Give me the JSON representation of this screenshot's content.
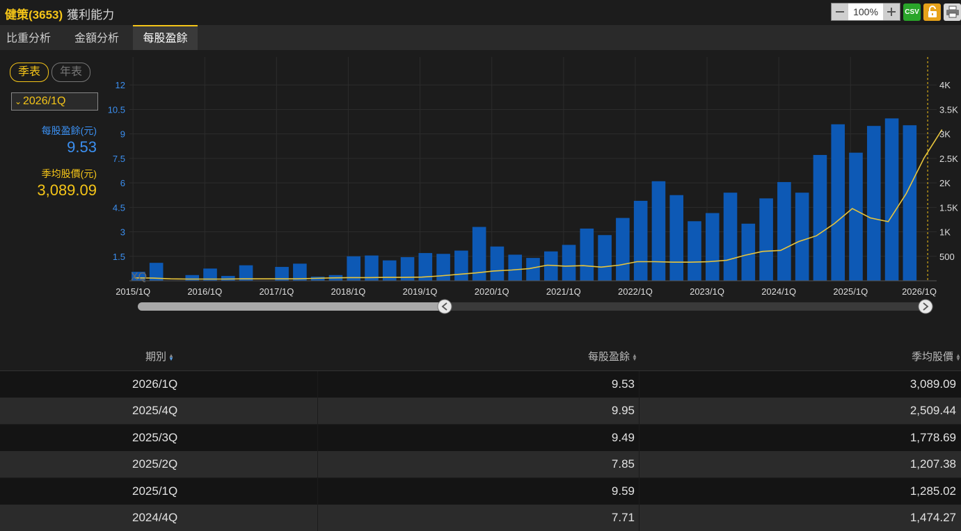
{
  "header": {
    "stock": "健策(3653)",
    "page": "獲利能力",
    "zoom_level": "100%",
    "csv_label": "CSV",
    "zoom_out_icon": "minus-icon",
    "zoom_in_icon": "plus-icon",
    "lock_icon": "lock-icon",
    "print_icon": "printer-icon"
  },
  "tabs": [
    {
      "label": "比重分析",
      "active": false
    },
    {
      "label": "金額分析",
      "active": false
    },
    {
      "label": "每股盈餘",
      "active": true
    }
  ],
  "controls": {
    "quarterly": "季表",
    "annual": "年表",
    "period": "2026/1Q"
  },
  "summary": {
    "eps_label": "每股盈餘(元)",
    "eps_value": "9.53",
    "price_label": "季均股價(元)",
    "price_value": "3,089.09"
  },
  "colors": {
    "bar": "#0d59b5",
    "bar_highlight": "#1a8cff",
    "line": "#e8c53c",
    "accent": "#f5c518",
    "left_axis": "#3b8ff0"
  },
  "chart_data": {
    "type": "bar",
    "watermark": "XQ",
    "x_tick_labels": [
      "2015/1Q",
      "2016/1Q",
      "2017/1Q",
      "2018/1Q",
      "2019/1Q",
      "2020/1Q",
      "2021/1Q",
      "2022/1Q",
      "2023/1Q",
      "2024/1Q",
      "2025/1Q",
      "2026/1Q"
    ],
    "left_ticks": [
      "1.5",
      "3",
      "4.5",
      "6",
      "7.5",
      "9",
      "10.5",
      "12"
    ],
    "right_ticks": [
      "500",
      "1K",
      "1.5K",
      "2K",
      "2.5K",
      "3K",
      "3.5K",
      "4K"
    ],
    "ylim_left": [
      0,
      13.5
    ],
    "ylim_right": [
      0,
      4500
    ],
    "grid": true,
    "categories": [
      "2015/1Q",
      "2015/2Q",
      "2015/3Q",
      "2015/4Q",
      "2016/1Q",
      "2016/2Q",
      "2016/3Q",
      "2016/4Q",
      "2017/1Q",
      "2017/2Q",
      "2017/3Q",
      "2017/4Q",
      "2018/1Q",
      "2018/2Q",
      "2018/3Q",
      "2018/4Q",
      "2019/1Q",
      "2019/2Q",
      "2019/3Q",
      "2019/4Q",
      "2020/1Q",
      "2020/2Q",
      "2020/3Q",
      "2020/4Q",
      "2021/1Q",
      "2021/2Q",
      "2021/3Q",
      "2021/4Q",
      "2022/1Q",
      "2022/2Q",
      "2022/3Q",
      "2022/4Q",
      "2023/1Q",
      "2023/2Q",
      "2023/3Q",
      "2023/4Q",
      "2024/1Q",
      "2024/2Q",
      "2024/3Q",
      "2024/4Q",
      "2025/1Q",
      "2025/2Q",
      "2025/3Q",
      "2025/4Q",
      "2026/1Q"
    ],
    "series": [
      {
        "name": "每股盈餘(元)",
        "axis": "left",
        "kind": "bar",
        "values": [
          0.55,
          1.1,
          0.0,
          0.35,
          0.75,
          0.3,
          0.95,
          0.0,
          0.85,
          1.05,
          0.25,
          0.35,
          1.5,
          1.55,
          1.25,
          1.45,
          1.7,
          1.65,
          1.85,
          3.3,
          2.1,
          1.6,
          1.4,
          1.8,
          2.2,
          3.2,
          2.8,
          3.85,
          4.9,
          6.1,
          5.25,
          3.65,
          4.15,
          5.4,
          3.5,
          5.05,
          6.05,
          5.4,
          7.71,
          9.59,
          7.85,
          9.49,
          9.95,
          9.53
        ]
      },
      {
        "name": "季均股價(元)",
        "axis": "right",
        "kind": "line",
        "values": [
          60,
          55,
          40,
          35,
          35,
          35,
          40,
          40,
          40,
          40,
          50,
          60,
          65,
          65,
          70,
          70,
          75,
          100,
          130,
          160,
          200,
          220,
          250,
          320,
          300,
          310,
          280,
          320,
          390,
          390,
          380,
          380,
          390,
          420,
          520,
          600,
          620,
          800,
          920,
          1170,
          1474.27,
          1285.02,
          1207.38,
          1778.69,
          2509.44,
          3089.09
        ]
      }
    ]
  },
  "table": {
    "headers": [
      "期別",
      "每股盈餘",
      "季均股價"
    ],
    "rows": [
      [
        "2026/1Q",
        "9.53",
        "3,089.09"
      ],
      [
        "2025/4Q",
        "9.95",
        "2,509.44"
      ],
      [
        "2025/3Q",
        "9.49",
        "1,778.69"
      ],
      [
        "2025/2Q",
        "7.85",
        "1,207.38"
      ],
      [
        "2025/1Q",
        "9.59",
        "1,285.02"
      ],
      [
        "2024/4Q",
        "7.71",
        "1,474.27"
      ]
    ]
  }
}
